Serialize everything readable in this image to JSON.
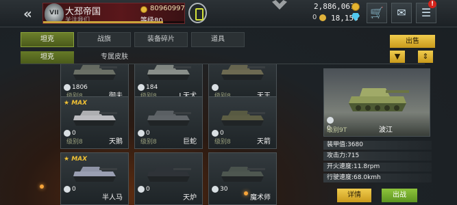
{
  "header": {
    "player": {
      "rank": "VII",
      "name": "大邳帝国",
      "subtitle": "关注我们",
      "coins": "80960997",
      "level_label": "等级80",
      "level_progress": 0.85
    },
    "currency": {
      "gold": "2,886,067",
      "silver_count": "0",
      "diamonds": "18,158"
    },
    "icons": {
      "cart": "cart-icon",
      "mail": "mail-icon",
      "chat": "chat-icon"
    },
    "chat_badge": "!"
  },
  "tabs": [
    {
      "label": "坦克"
    },
    {
      "label": "战旗"
    },
    {
      "label": "装备碎片"
    },
    {
      "label": "道具"
    }
  ],
  "subtabs": [
    {
      "label": "坦克"
    },
    {
      "label": "专属皮肤"
    }
  ],
  "sell_label": "出售",
  "filter_icons": [
    "filter-icon",
    "sort-icon"
  ],
  "cards": [
    {
      "count": "1806",
      "level": "级别8",
      "name": "御夫",
      "max": "",
      "color": "#6b7066"
    },
    {
      "count": "184",
      "level": "级别8",
      "name": "L天犬",
      "max": "",
      "color": "#8a8f8a"
    },
    {
      "count": "",
      "level": "级别8",
      "name": "天王",
      "max": "",
      "color": "#6d6a52"
    },
    {
      "count": "0",
      "level": "级别8",
      "name": "天鹅",
      "max": "MAX",
      "color": "#bcbcc0"
    },
    {
      "count": "0",
      "level": "级别8",
      "name": "巨蛇",
      "max": "",
      "color": "#5f6468"
    },
    {
      "count": "0",
      "level": "级别8",
      "name": "天箭",
      "max": "",
      "color": "#5d5e44"
    },
    {
      "count": "0",
      "level": "",
      "name": "半人马",
      "max": "MAX",
      "color": "#9a9fb2"
    },
    {
      "count": "0",
      "level": "",
      "name": "天炉",
      "max": "",
      "color": "#2f3338"
    },
    {
      "count": "30",
      "level": "",
      "name": "魔术师",
      "max": "",
      "color": "#4e5750"
    }
  ],
  "detail": {
    "count": "0",
    "level": "级别9T",
    "name": "波江",
    "stats": [
      "装甲值:3680",
      "攻击力:715",
      "开火速度:11.8rpm",
      "行驶速度:68.0kmh"
    ],
    "detail_btn": "详情",
    "deploy_btn": "出战"
  }
}
